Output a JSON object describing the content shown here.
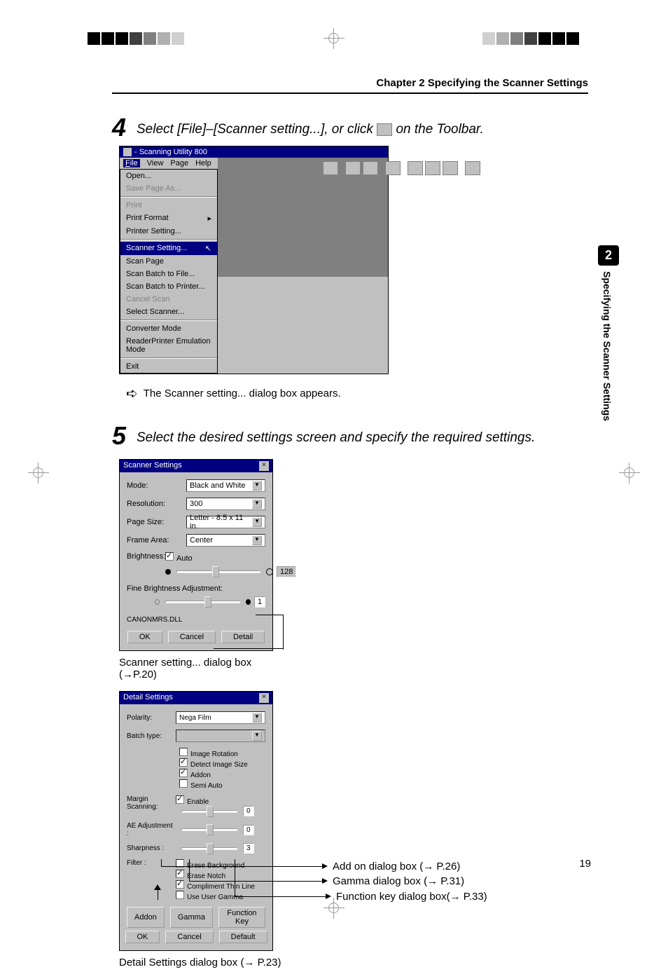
{
  "header": {
    "chapter_title": "Chapter 2 Specifying the Scanner Settings"
  },
  "side_tab": {
    "number": "2",
    "text": "Specifying the Scanner Settings"
  },
  "step4": {
    "number": "4",
    "text_before": "Select [File]–[Scanner setting...], or click ",
    "text_after": " on the Toolbar."
  },
  "app_window": {
    "title": " - Scanning Utility 800",
    "menu": {
      "file": "File",
      "view": "View",
      "page": "Page",
      "help": "Help"
    },
    "file_menu": {
      "open": "Open...",
      "save_as": "Save Page As...",
      "print": "Print",
      "print_format": "Print Format",
      "printer_setting": "Printer Setting...",
      "scanner_setting": "Scanner Setting...",
      "scan_page": "Scan Page",
      "scan_batch_file": "Scan Batch to File...",
      "scan_batch_printer": "Scan Batch to Printer...",
      "cancel_scan": "Cancel Scan",
      "select_scanner": "Select Scanner...",
      "converter_mode": "Converter Mode",
      "reader_printer": "ReaderPrinter Emulation Mode",
      "exit": "Exit"
    }
  },
  "result4": {
    "text": "The Scanner setting... dialog box appears."
  },
  "step5": {
    "number": "5",
    "text": "Select the desired settings screen and specify the required settings."
  },
  "scanner_dialog": {
    "title": "Scanner Settings",
    "mode_label": "Mode:",
    "mode_value": "Black and White",
    "resolution_label": "Resolution:",
    "resolution_value": "300",
    "page_size_label": "Page Size:",
    "page_size_value": "Letter - 8.5 x 11 in.",
    "frame_area_label": "Frame Area:",
    "frame_area_value": "Center",
    "brightness_label": "Brightness:",
    "auto_check": "Auto",
    "brightness_value": "128",
    "fine_brightness_label": "Fine Brightness Adjustment:",
    "fine_value": "1",
    "dll": "CANONMRS.DLL",
    "ok": "OK",
    "cancel": "Cancel",
    "detail": "Detail"
  },
  "scanner_caption": "Scanner setting... dialog box",
  "scanner_caption_ref": "(→P.20)",
  "detail_dialog": {
    "title": "Detail Settings",
    "polarity_label": "Polarity:",
    "polarity_value": "Nega Film",
    "batch_label": "Batch type:",
    "image_rotation": "Image Rotation",
    "detect_image_size": "Detect Image Size",
    "addon_check": "Addon",
    "semi_auto": "Semi Auto",
    "margin_label": "Margin Scanning:",
    "enable": "Enable",
    "margin_value": "0",
    "ae_label": "AE Adjustment :",
    "ae_value": "0",
    "sharpness_label": "Sharpness :",
    "sharpness_value": "3",
    "filter_label": "Filter :",
    "erase_background": "Erase Background",
    "erase_notch": "Erase Notch",
    "compliment": "Compliment Thin Line",
    "use_gamma": "Use User Gamma",
    "addon_btn": "Addon",
    "gamma_btn": "Gamma",
    "function_key_btn": "Function Key",
    "ok": "OK",
    "cancel": "Cancel",
    "default": "Default"
  },
  "detail_caption": "Detail Settings dialog box  (→ P.23)",
  "callouts": {
    "addon": "Add on dialog box (→ P.26)",
    "gamma": "Gamma dialog box (→ P.31)",
    "function_key": "Function key dialog box(→ P.33)"
  },
  "page_number": "19"
}
